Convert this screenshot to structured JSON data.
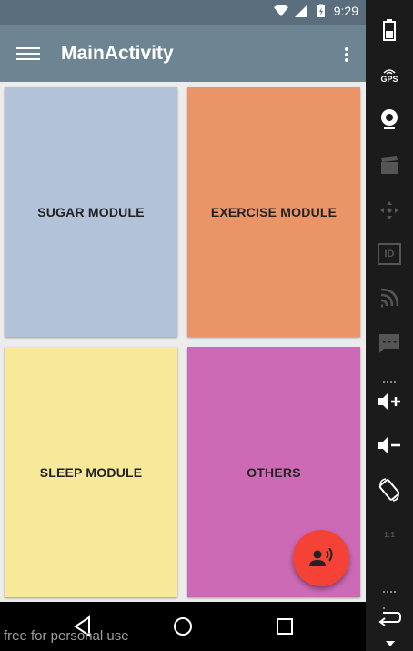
{
  "status_bar": {
    "time": "9:29"
  },
  "app_bar": {
    "title": "MainActivity"
  },
  "tiles": [
    {
      "label": "SUGAR MODULE",
      "color": "#b1c2d9"
    },
    {
      "label": "EXERCISE MODULE",
      "color": "#ea9567"
    },
    {
      "label": "SLEEP MODULE",
      "color": "#f7e998"
    },
    {
      "label": "OTHERS",
      "color": "#cd6ab6"
    }
  ],
  "fab": {
    "color": "#f44336",
    "icon": "voice-person-icon"
  },
  "watermark": "free for personal use",
  "emulator_panel": {
    "items": [
      "battery-icon",
      "gps-icon",
      "camera-icon",
      "media-icon",
      "dpad-icon",
      "id-icon",
      "cast-icon",
      "message-icon",
      "volume-up-icon",
      "volume-down-icon",
      "rotate-icon",
      "scale-icon",
      "back-icon"
    ],
    "gps_label": "GPS",
    "id_label": "ID",
    "scale_label": "1:1"
  }
}
